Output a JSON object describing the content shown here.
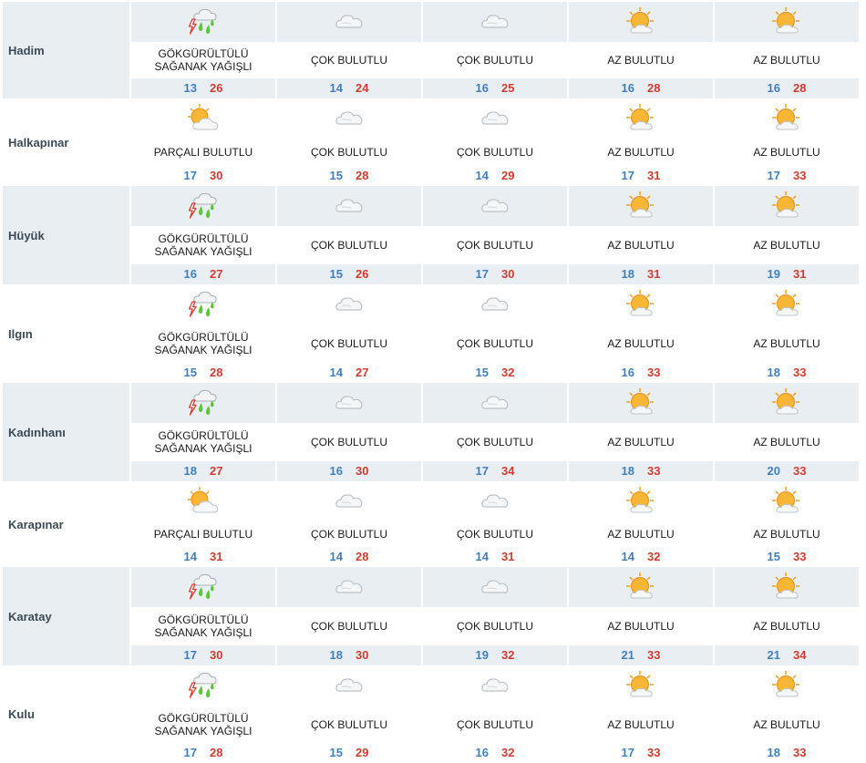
{
  "colors": {
    "band": "#e9eef2",
    "min_temp": "#3f7fc0",
    "max_temp": "#d43b2f",
    "city": "#3b4a55"
  },
  "rows": [
    {
      "city": "Hadim",
      "days": [
        {
          "icon": "thunderstorm-rain-icon",
          "condition": [
            "GÖKGÜRÜLTÜLÜ",
            "SAĞANAK YAĞIŞLI"
          ],
          "min": "13",
          "max": "26"
        },
        {
          "icon": "cloudy-icon",
          "condition": [
            "ÇOK BULUTLU"
          ],
          "min": "14",
          "max": "24"
        },
        {
          "icon": "cloudy-icon",
          "condition": [
            "ÇOK BULUTLU"
          ],
          "min": "16",
          "max": "25"
        },
        {
          "icon": "sun-cloud-icon",
          "condition": [
            "AZ BULUTLU"
          ],
          "min": "16",
          "max": "28"
        },
        {
          "icon": "sun-cloud-icon",
          "condition": [
            "AZ BULUTLU"
          ],
          "min": "16",
          "max": "28"
        }
      ]
    },
    {
      "city": "Halkapınar",
      "days": [
        {
          "icon": "partly-cloudy-icon",
          "condition": [
            "PARÇALI BULUTLU"
          ],
          "min": "17",
          "max": "30"
        },
        {
          "icon": "cloudy-icon",
          "condition": [
            "ÇOK BULUTLU"
          ],
          "min": "15",
          "max": "28"
        },
        {
          "icon": "cloudy-icon",
          "condition": [
            "ÇOK BULUTLU"
          ],
          "min": "14",
          "max": "29"
        },
        {
          "icon": "sun-cloud-icon",
          "condition": [
            "AZ BULUTLU"
          ],
          "min": "17",
          "max": "31"
        },
        {
          "icon": "sun-cloud-icon",
          "condition": [
            "AZ BULUTLU"
          ],
          "min": "17",
          "max": "33"
        }
      ]
    },
    {
      "city": "Hüyük",
      "days": [
        {
          "icon": "thunderstorm-rain-icon",
          "condition": [
            "GÖKGÜRÜLTÜLÜ",
            "SAĞANAK YAĞIŞLI"
          ],
          "min": "16",
          "max": "27"
        },
        {
          "icon": "cloudy-icon",
          "condition": [
            "ÇOK BULUTLU"
          ],
          "min": "15",
          "max": "26"
        },
        {
          "icon": "cloudy-icon",
          "condition": [
            "ÇOK BULUTLU"
          ],
          "min": "17",
          "max": "30"
        },
        {
          "icon": "sun-cloud-icon",
          "condition": [
            "AZ BULUTLU"
          ],
          "min": "18",
          "max": "31"
        },
        {
          "icon": "sun-cloud-icon",
          "condition": [
            "AZ BULUTLU"
          ],
          "min": "19",
          "max": "31"
        }
      ]
    },
    {
      "city": "Ilgın",
      "days": [
        {
          "icon": "thunderstorm-rain-icon",
          "condition": [
            "GÖKGÜRÜLTÜLÜ",
            "SAĞANAK YAĞIŞLI"
          ],
          "min": "15",
          "max": "28"
        },
        {
          "icon": "cloudy-icon",
          "condition": [
            "ÇOK BULUTLU"
          ],
          "min": "14",
          "max": "27"
        },
        {
          "icon": "cloudy-icon",
          "condition": [
            "ÇOK BULUTLU"
          ],
          "min": "15",
          "max": "32"
        },
        {
          "icon": "sun-cloud-icon",
          "condition": [
            "AZ BULUTLU"
          ],
          "min": "16",
          "max": "33"
        },
        {
          "icon": "sun-cloud-icon",
          "condition": [
            "AZ BULUTLU"
          ],
          "min": "18",
          "max": "33"
        }
      ]
    },
    {
      "city": "Kadınhanı",
      "days": [
        {
          "icon": "thunderstorm-rain-icon",
          "condition": [
            "GÖKGÜRÜLTÜLÜ",
            "SAĞANAK YAĞIŞLI"
          ],
          "min": "18",
          "max": "27"
        },
        {
          "icon": "cloudy-icon",
          "condition": [
            "ÇOK BULUTLU"
          ],
          "min": "16",
          "max": "30"
        },
        {
          "icon": "cloudy-icon",
          "condition": [
            "ÇOK BULUTLU"
          ],
          "min": "17",
          "max": "34"
        },
        {
          "icon": "sun-cloud-icon",
          "condition": [
            "AZ BULUTLU"
          ],
          "min": "18",
          "max": "33"
        },
        {
          "icon": "sun-cloud-icon",
          "condition": [
            "AZ BULUTLU"
          ],
          "min": "20",
          "max": "33"
        }
      ]
    },
    {
      "city": "Karapınar",
      "days": [
        {
          "icon": "partly-cloudy-icon",
          "condition": [
            "PARÇALI BULUTLU"
          ],
          "min": "14",
          "max": "31"
        },
        {
          "icon": "cloudy-icon",
          "condition": [
            "ÇOK BULUTLU"
          ],
          "min": "14",
          "max": "28"
        },
        {
          "icon": "cloudy-icon",
          "condition": [
            "ÇOK BULUTLU"
          ],
          "min": "14",
          "max": "31"
        },
        {
          "icon": "sun-cloud-icon",
          "condition": [
            "AZ BULUTLU"
          ],
          "min": "14",
          "max": "32"
        },
        {
          "icon": "sun-cloud-icon",
          "condition": [
            "AZ BULUTLU"
          ],
          "min": "15",
          "max": "33"
        }
      ]
    },
    {
      "city": "Karatay",
      "days": [
        {
          "icon": "thunderstorm-rain-icon",
          "condition": [
            "GÖKGÜRÜLTÜLÜ",
            "SAĞANAK YAĞIŞLI"
          ],
          "min": "17",
          "max": "30"
        },
        {
          "icon": "cloudy-icon",
          "condition": [
            "ÇOK BULUTLU"
          ],
          "min": "18",
          "max": "30"
        },
        {
          "icon": "cloudy-icon",
          "condition": [
            "ÇOK BULUTLU"
          ],
          "min": "19",
          "max": "32"
        },
        {
          "icon": "sun-cloud-icon",
          "condition": [
            "AZ BULUTLU"
          ],
          "min": "21",
          "max": "33"
        },
        {
          "icon": "sun-cloud-icon",
          "condition": [
            "AZ BULUTLU"
          ],
          "min": "21",
          "max": "34"
        }
      ]
    },
    {
      "city": "Kulu",
      "days": [
        {
          "icon": "thunderstorm-rain-icon",
          "condition": [
            "GÖKGÜRÜLTÜLÜ",
            "SAĞANAK YAĞIŞLI"
          ],
          "min": "17",
          "max": "28"
        },
        {
          "icon": "cloudy-icon",
          "condition": [
            "ÇOK BULUTLU"
          ],
          "min": "15",
          "max": "29"
        },
        {
          "icon": "cloudy-icon",
          "condition": [
            "ÇOK BULUTLU"
          ],
          "min": "16",
          "max": "32"
        },
        {
          "icon": "sun-cloud-icon",
          "condition": [
            "AZ BULUTLU"
          ],
          "min": "17",
          "max": "33"
        },
        {
          "icon": "sun-cloud-icon",
          "condition": [
            "AZ BULUTLU"
          ],
          "min": "18",
          "max": "33"
        }
      ]
    }
  ]
}
